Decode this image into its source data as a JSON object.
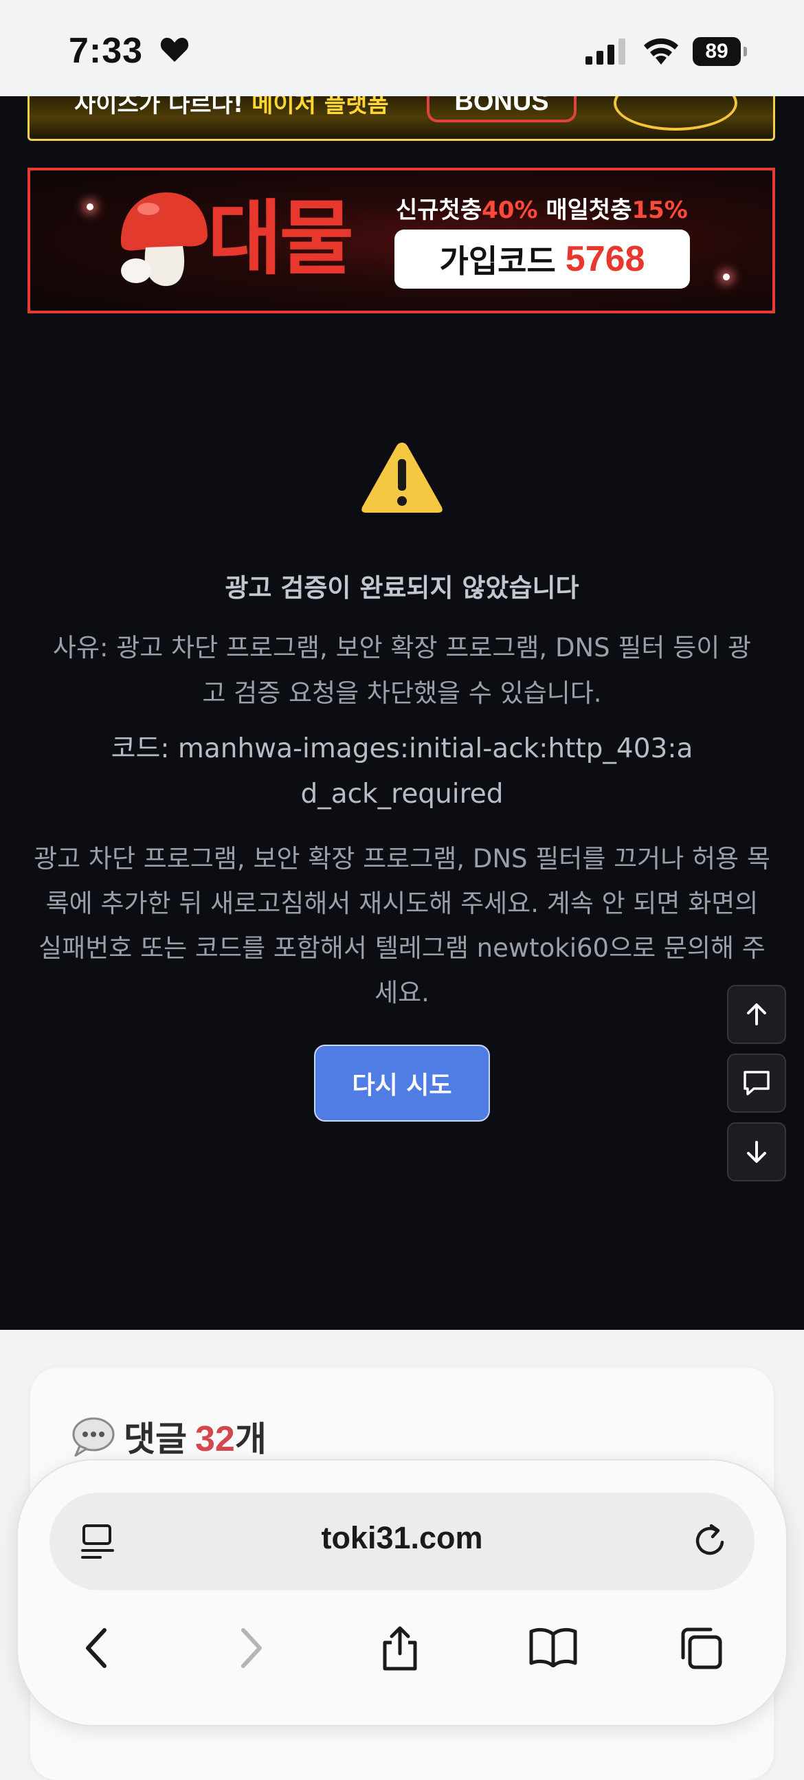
{
  "status_bar": {
    "time": "7:33",
    "battery": "89"
  },
  "ad_banner_top": {
    "text_white": "사이즈가 다르다!",
    "text_yellow": "메이저 플랫폼",
    "bonus_label": "BONUS"
  },
  "ad_banner_main": {
    "big_text": "대물",
    "promo_1_label": "신규첫충",
    "promo_1_value": "40%",
    "promo_2_label": "매일첫충",
    "promo_2_value": "15%",
    "code_label": "가입코드",
    "code_value": "5768"
  },
  "error": {
    "title": "광고 검증이 완료되지 않았습니다",
    "reason": "사유: 광고 차단 프로그램, 보안 확장 프로그램, DNS 필터 등이 광고 검증 요청을 차단했을 수 있습니다.",
    "code": "코드: manhwa-images:initial-ack:http_403:ad_ack_required",
    "help": "광고 차단 프로그램, 보안 확장 프로그램, DNS 필터를 끄거나 허용 목록에 추가한 뒤 새로고침해서 재시도해 주세요. 계속 안 되면 화면의 실패번호 또는 코드를 포함해서 텔레그램 newtoki60으로 문의해 주세요.",
    "retry_label": "다시 시도"
  },
  "comments": {
    "title": "댓글",
    "count": "32",
    "unit": "개"
  },
  "browser": {
    "url": "toki31.com"
  },
  "colors": {
    "accent_blue": "#4f7de3",
    "ad_red": "#e8372c",
    "count_red": "#d2484d"
  }
}
